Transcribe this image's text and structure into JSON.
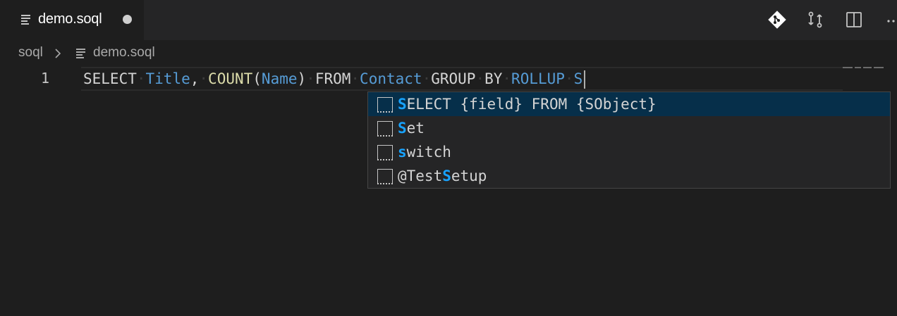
{
  "tab": {
    "title": "demo.soql",
    "file_icon": "file-lines-icon",
    "dirty_indicator": "unsaved-dot"
  },
  "actions": [
    {
      "name": "git-icon"
    },
    {
      "name": "open-changes-icon"
    },
    {
      "name": "split-editor-icon"
    },
    {
      "name": "more-actions-icon",
      "label": "···"
    }
  ],
  "breadcrumb": {
    "root": "soql",
    "file": "demo.soql"
  },
  "editor": {
    "line_number": "1",
    "tokens": [
      {
        "text": "SELECT",
        "kind": "kw"
      },
      {
        "text": "Title",
        "kind": "id"
      },
      {
        "text": ",",
        "kind": "pn",
        "nospace": true
      },
      {
        "text": "COUNT",
        "kind": "fn"
      },
      {
        "text": "(",
        "kind": "pn",
        "nospace": true
      },
      {
        "text": "Name",
        "kind": "id",
        "nospace": true
      },
      {
        "text": ")",
        "kind": "pn",
        "nospace": true
      },
      {
        "text": "FROM",
        "kind": "kw"
      },
      {
        "text": "Contact",
        "kind": "id"
      },
      {
        "text": "GROUP",
        "kind": "kw"
      },
      {
        "text": "BY",
        "kind": "kw"
      },
      {
        "text": "ROLLUP",
        "kind": "id"
      },
      {
        "text": "S",
        "kind": "id"
      }
    ]
  },
  "suggestions": [
    {
      "pre": "",
      "match": "S",
      "post": "ELECT {field} FROM {SObject}",
      "active": true,
      "icon": "snippet-icon"
    },
    {
      "pre": "",
      "match": "S",
      "post": "et",
      "active": false,
      "icon": "snippet-icon"
    },
    {
      "pre": "",
      "match": "s",
      "post": "witch",
      "active": false,
      "icon": "snippet-icon"
    },
    {
      "pre": "@Test",
      "match": "S",
      "post": "etup",
      "active": false,
      "icon": "snippet-icon"
    }
  ],
  "colors": {
    "editor_bg": "#1e1e1e",
    "tab_bar_bg": "#252526",
    "keyword": "#d4d4d4",
    "identifier": "#569cd6",
    "function": "#dcdcaa",
    "match_highlight": "#18a3ff",
    "selection_bg": "#062f4a"
  }
}
